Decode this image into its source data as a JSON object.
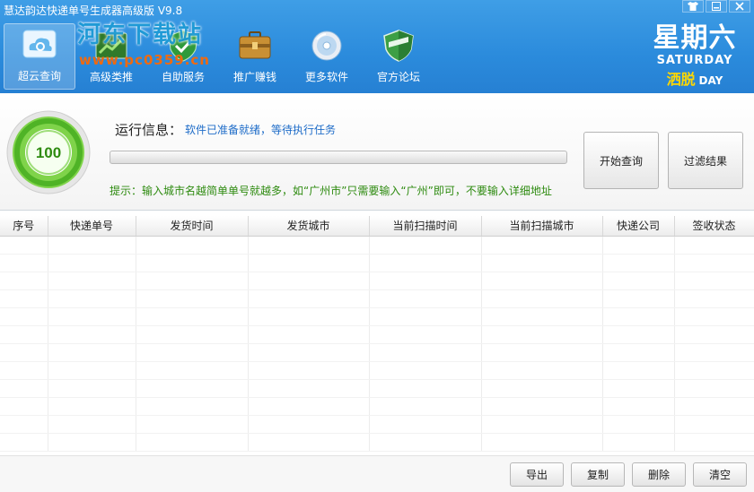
{
  "window": {
    "title": "慧达韵达快递单号生成器高级版 V9.8",
    "controls": [
      "shirt-icon",
      "minimize-icon",
      "close-icon"
    ]
  },
  "watermark": {
    "line1": "河东下载站",
    "line2": "www.pc0359.cn"
  },
  "toolbar": {
    "items": [
      {
        "label": "超云查询",
        "icon": "cloud-search-icon",
        "active": true
      },
      {
        "label": "高级类推",
        "icon": "chart-icon",
        "active": false
      },
      {
        "label": "自助服务",
        "icon": "shield-service-icon",
        "active": false
      },
      {
        "label": "推广赚钱",
        "icon": "briefcase-icon",
        "active": false
      },
      {
        "label": "更多软件",
        "icon": "disc-icon",
        "active": false
      },
      {
        "label": "官方论坛",
        "icon": "forum-shield-icon",
        "active": false
      }
    ]
  },
  "weekday": {
    "chinese": "星期六",
    "english": "SATURDAY",
    "mood": "洒脱",
    "day": "DAY"
  },
  "status": {
    "gauge_value": "100",
    "run_label": "运行信息：",
    "run_text": "软件已准备就绪，等待执行任务",
    "progress_fraction": 0.0,
    "tip": "提示：输入城市名越简单单号就越多，如“广州市”只需要输入“广州”即可，不要输入详细地址",
    "start_button": "开始查询",
    "filter_button": "过滤结果"
  },
  "table": {
    "columns": [
      "序号",
      "快递单号",
      "发货时间",
      "发货城市",
      "当前扫描时间",
      "当前扫描城市",
      "快递公司",
      "签收状态"
    ],
    "rows": []
  },
  "actions": {
    "export": "导出",
    "copy": "复制",
    "delete": "删除",
    "clear": "清空"
  },
  "colors": {
    "banner": "#2b8bdc",
    "accent_green": "#5cc02b",
    "info_blue": "#1e6cc8",
    "tip_green": "#2e8b10"
  }
}
